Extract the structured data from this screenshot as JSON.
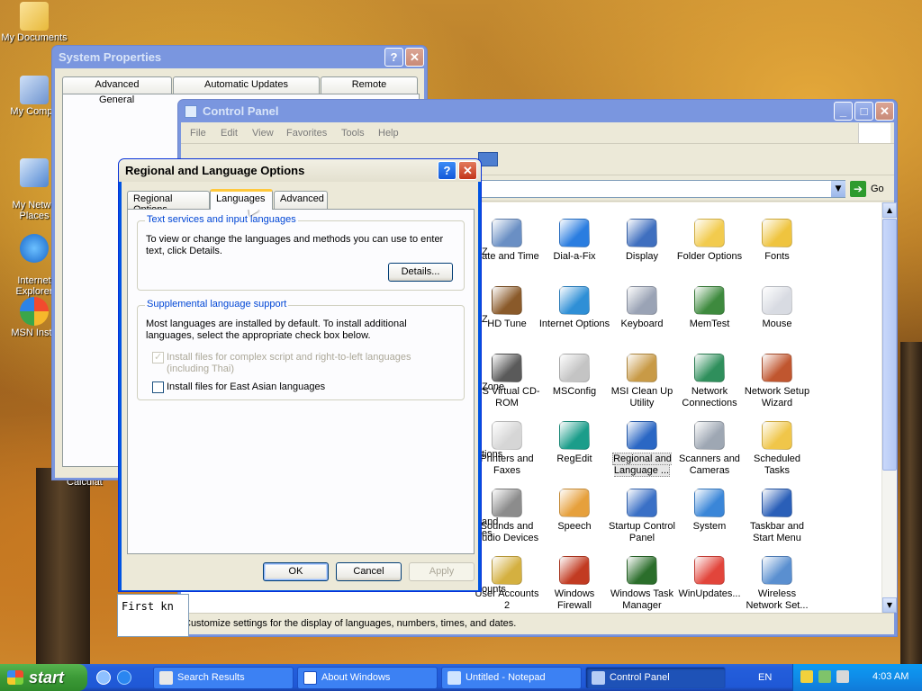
{
  "desktop": {
    "icons": [
      {
        "label": "My Documents"
      },
      {
        "label": "My Compu"
      },
      {
        "label": "My Netwo\nPlaces"
      },
      {
        "label": "Internet\nExplorer"
      },
      {
        "label": "MSN Insta"
      }
    ],
    "calc_label": "Calculat"
  },
  "system_properties": {
    "title": "System Properties",
    "tabs_row1": [
      "Advanced",
      "Automatic Updates",
      "Remote"
    ],
    "tab_general": "General"
  },
  "control_panel": {
    "title": "Control Panel",
    "menu": [
      "File",
      "Edit",
      "View",
      "Favorites",
      "Tools",
      "Help"
    ],
    "go_label": "Go",
    "status_text": "Customize settings for the display of languages, numbers, times, and dates.",
    "partial_labels": [
      "Z",
      "Z",
      "Zone",
      "tions",
      "and\nes",
      "ounts"
    ],
    "items": [
      {
        "label": "Date and Time",
        "icon": "date-time-icon",
        "color": "#6a8fc4"
      },
      {
        "label": "Dial-a-Fix",
        "icon": "gear-icon",
        "color": "#2a7de0"
      },
      {
        "label": "Display",
        "icon": "display-icon",
        "color": "#3f6fbf"
      },
      {
        "label": "Folder Options",
        "icon": "folder-icon",
        "color": "#f2cb4e"
      },
      {
        "label": "Fonts",
        "icon": "fonts-folder-icon",
        "color": "#efc43f"
      },
      {
        "label": "HD Tune",
        "icon": "hard-disk-icon",
        "color": "#8a5a2a"
      },
      {
        "label": "Internet Options",
        "icon": "globe-icon",
        "color": "#2f8fd6"
      },
      {
        "label": "Keyboard",
        "icon": "keyboard-icon",
        "color": "#9aa3b5"
      },
      {
        "label": "MemTest",
        "icon": "memory-icon",
        "color": "#3e8a3e"
      },
      {
        "label": "Mouse",
        "icon": "mouse-icon",
        "color": "#d8dbe2"
      },
      {
        "label": "MS Virtual CD-ROM",
        "icon": "cd-icon",
        "color": "#5a5a5a"
      },
      {
        "label": "MSConfig",
        "icon": "msconfig-icon",
        "color": "#c4c4c4"
      },
      {
        "label": "MSI Clean Up Utility",
        "icon": "broom-icon",
        "color": "#c89a46"
      },
      {
        "label": "Network Connections",
        "icon": "network-globe-icon",
        "color": "#2f8f5c"
      },
      {
        "label": "Network Setup Wizard",
        "icon": "home-network-icon",
        "color": "#c0562f"
      },
      {
        "label": "Printers and Faxes",
        "icon": "printer-icon",
        "color": "#d6d6d6"
      },
      {
        "label": "RegEdit",
        "icon": "regedit-icon",
        "color": "#1b9d8a"
      },
      {
        "label": "Regional and Language ...",
        "icon": "regional-globe-icon",
        "color": "#2a67c4",
        "selected": true
      },
      {
        "label": "Scanners and Cameras",
        "icon": "scanner-icon",
        "color": "#9ea7b3"
      },
      {
        "label": "Scheduled Tasks",
        "icon": "scheduled-folder-icon",
        "color": "#f0c64a"
      },
      {
        "label": "Sounds and Audio Devices",
        "icon": "speaker-icon",
        "color": "#8c8c8c"
      },
      {
        "label": "Speech",
        "icon": "speech-icon",
        "color": "#e6a03c"
      },
      {
        "label": "Startup Control Panel",
        "icon": "startup-icon",
        "color": "#3a70c6"
      },
      {
        "label": "System",
        "icon": "system-icon",
        "color": "#3a86d8"
      },
      {
        "label": "Taskbar and Start Menu",
        "icon": "taskbar-icon",
        "color": "#2a5fb8"
      },
      {
        "label": "User Accounts 2",
        "icon": "keys-icon",
        "color": "#d4b040"
      },
      {
        "label": "Windows Firewall",
        "icon": "firewall-icon",
        "color": "#c23b22"
      },
      {
        "label": "Windows Task Manager",
        "icon": "task-manager-icon",
        "color": "#2b6e2b"
      },
      {
        "label": "WinUpdates...",
        "icon": "windows-flag-icon",
        "color": "#e2453b"
      },
      {
        "label": "Wireless Network Set...",
        "icon": "wireless-icon",
        "color": "#5a8fd0"
      }
    ]
  },
  "dialog": {
    "title": "Regional and Language Options",
    "tabs": [
      "Regional Options",
      "Languages",
      "Advanced"
    ],
    "active_tab": "Languages",
    "group1": {
      "legend": "Text services and input languages",
      "text": "To view or change the languages and methods you can use to enter text, click Details.",
      "details_button": "Details..."
    },
    "group2": {
      "legend": "Supplemental language support",
      "text": "Most languages are installed by default. To install additional languages, select the appropriate check box below.",
      "checkbox1": {
        "label": "Install files for complex script and right-to-left languages (including Thai)",
        "checked": true,
        "disabled": true
      },
      "checkbox2": {
        "label": "Install files for East Asian languages",
        "checked": false
      }
    },
    "ok": "OK",
    "cancel": "Cancel",
    "apply": "Apply",
    "notepad_peek": "First kn"
  },
  "taskbar": {
    "start": "start",
    "tasks": [
      {
        "label": "Search Results"
      },
      {
        "label": "About Windows"
      },
      {
        "label": "Untitled - Notepad"
      },
      {
        "label": "Control Panel",
        "active": true
      }
    ],
    "language": "EN",
    "clock": "4:03 AM"
  }
}
